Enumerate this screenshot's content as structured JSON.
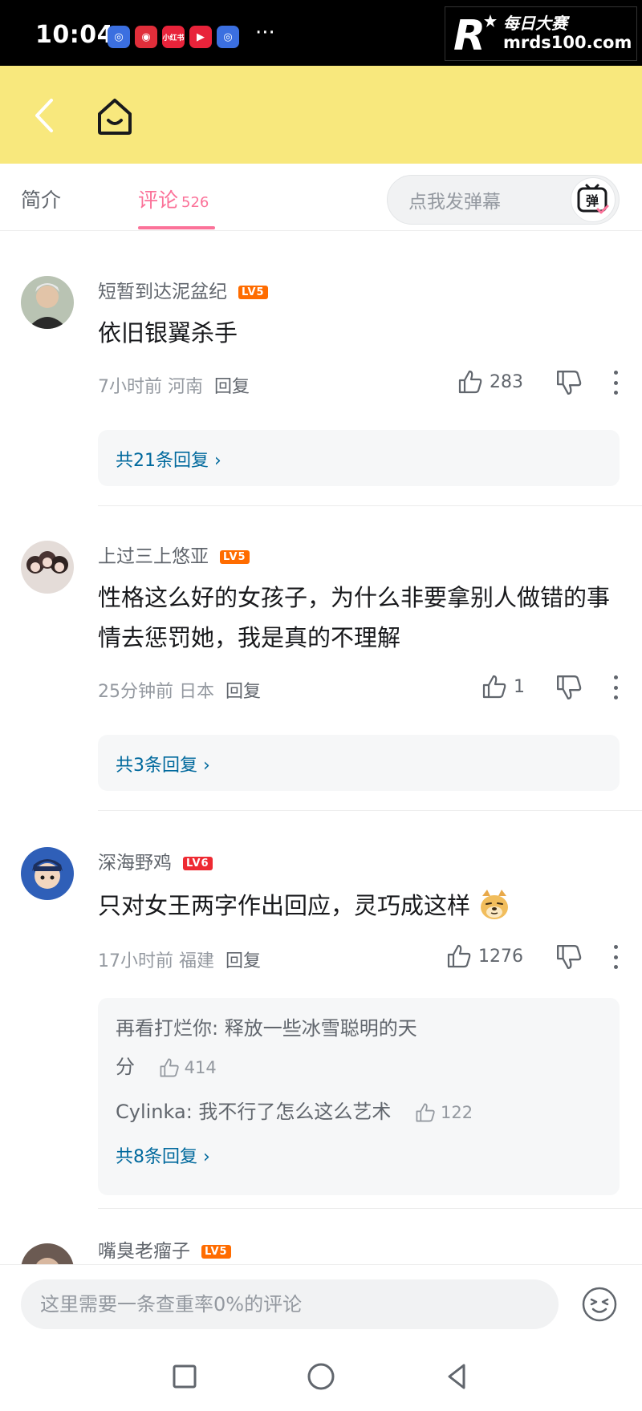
{
  "status_bar": {
    "time": "10:04",
    "more": "···",
    "app_icons": [
      "app-blue-icon",
      "app-red-icon",
      "app-mini-label-icon",
      "app-play-icon",
      "app-blue-icon"
    ],
    "mini_label": "小红书"
  },
  "watermark": {
    "brand_cn": "每日大赛",
    "url": "mrds100.com",
    "logo_letter": "R"
  },
  "tabs": {
    "intro": "简介",
    "comments": "评论",
    "comments_count": "526",
    "danmaku_placeholder": "点我发弹幕",
    "danmaku_icon_char": "弹"
  },
  "comments": [
    {
      "username": "短暂到达泥盆纪",
      "level": "LV5",
      "text": "依旧银翼杀手",
      "time_location": "7小时前 河南",
      "reply_label": "回复",
      "likes": "283",
      "reply_total": "共21条回复 ›"
    },
    {
      "username": "上过三上悠亚",
      "level": "LV5",
      "text": "性格这么好的女孩子，为什么非要拿别人做错的事情去惩罚她，我是真的不理解",
      "time_location": "25分钟前 日本",
      "reply_label": "回复",
      "likes": "1",
      "reply_total": "共3条回复 ›"
    },
    {
      "username": "深海野鸡",
      "level": "LV6",
      "text": "只对女王两字作出回应，灵巧成这样",
      "time_location": "17小时前 福建",
      "reply_label": "回复",
      "likes": "1276",
      "replies": [
        {
          "line1": "再看打烂你: 释放一些冰雪聪明的天",
          "line2": "分",
          "likes": "414"
        },
        {
          "line1": "Cylinka: 我不行了怎么这么艺术",
          "likes": "122"
        }
      ],
      "reply_total": "共8条回复 ›"
    },
    {
      "username": "嘴臭老瘤子",
      "level": "LV5"
    }
  ],
  "input_bar": {
    "placeholder": "这里需要一条查重率0%的评论"
  }
}
